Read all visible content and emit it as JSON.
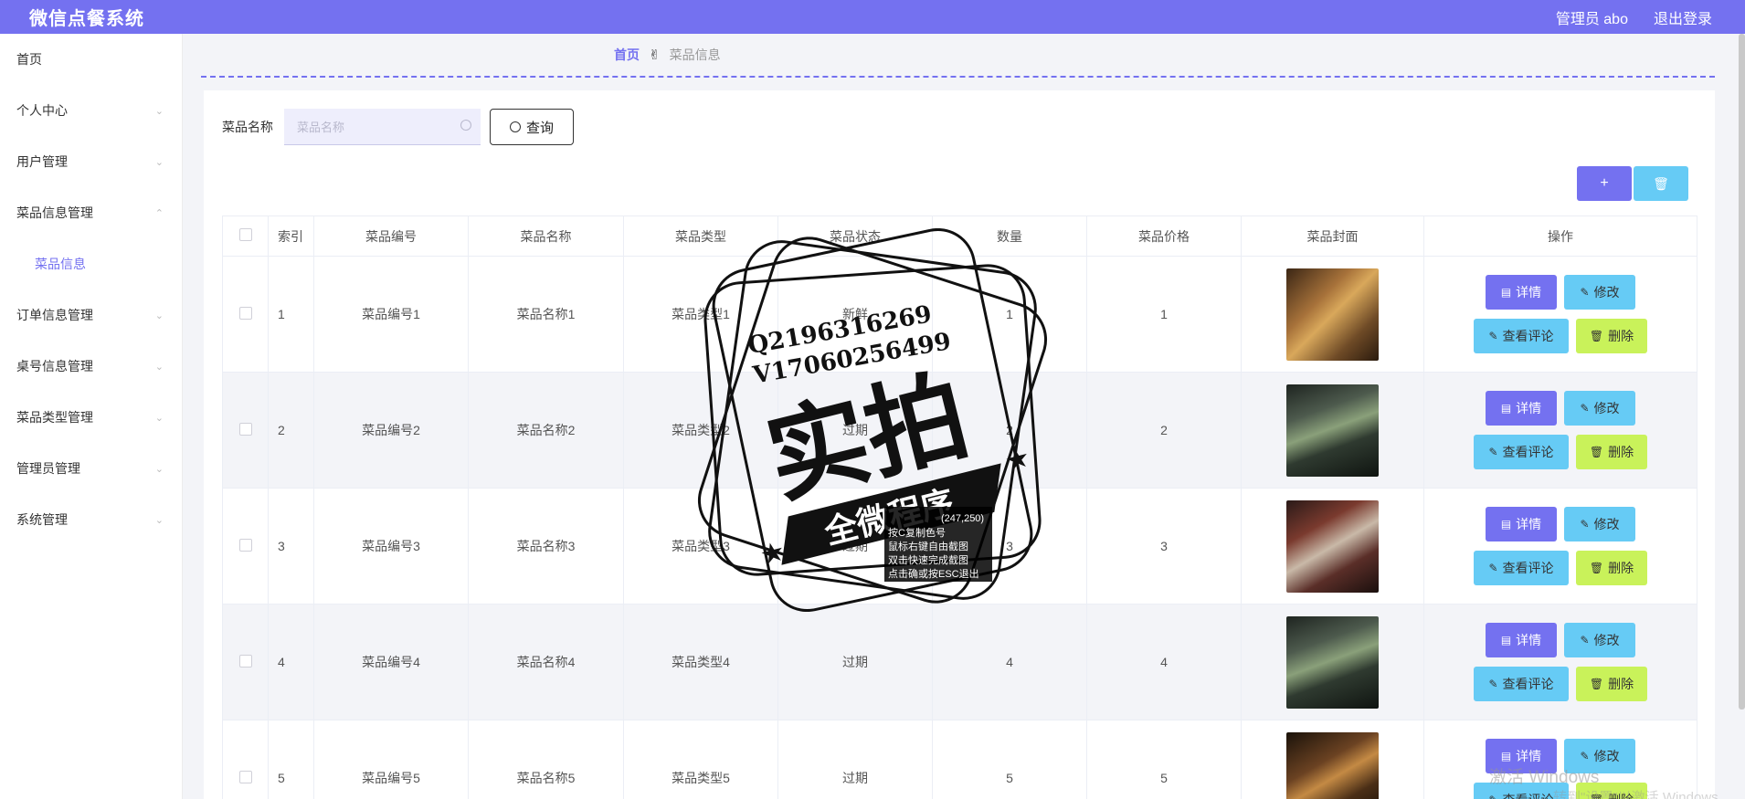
{
  "app": {
    "title": "微信点餐系统",
    "admin_label": "管理员 abo",
    "logout_label": "退出登录"
  },
  "sidebar": {
    "items": [
      {
        "label": "首页",
        "chevron": ""
      },
      {
        "label": "个人中心",
        "chevron": "⌄"
      },
      {
        "label": "用户管理",
        "chevron": "⌄"
      },
      {
        "label": "菜品信息管理",
        "chevron": "⌃"
      },
      {
        "label": "菜品信息",
        "chevron": ""
      },
      {
        "label": "订单信息管理",
        "chevron": "⌄"
      },
      {
        "label": "桌号信息管理",
        "chevron": "⌄"
      },
      {
        "label": "菜品类型管理",
        "chevron": "⌄"
      },
      {
        "label": "管理员管理",
        "chevron": "⌄"
      },
      {
        "label": "系统管理",
        "chevron": "⌄"
      }
    ]
  },
  "breadcrumb": {
    "home": "首页",
    "separator": "✌",
    "current": "菜品信息"
  },
  "search": {
    "label": "菜品名称",
    "placeholder": "菜品名称",
    "button": "查询"
  },
  "toolbar": {
    "add_label": "+",
    "delete_label": "🗑"
  },
  "table": {
    "headers": [
      "",
      "索引",
      "菜品编号",
      "菜品名称",
      "菜品类型",
      "菜品状态",
      "数量",
      "菜品价格",
      "菜品封面",
      "操作"
    ],
    "rows": [
      {
        "index": "1",
        "code": "菜品编号1",
        "name": "菜品名称1",
        "type": "菜品类型1",
        "status": "新鲜",
        "qty": "1",
        "price": "1"
      },
      {
        "index": "2",
        "code": "菜品编号2",
        "name": "菜品名称2",
        "type": "菜品类型2",
        "status": "过期",
        "qty": "2",
        "price": "2"
      },
      {
        "index": "3",
        "code": "菜品编号3",
        "name": "菜品名称3",
        "type": "菜品类型3",
        "status": "过期",
        "qty": "3",
        "price": "3"
      },
      {
        "index": "4",
        "code": "菜品编号4",
        "name": "菜品名称4",
        "type": "菜品类型4",
        "status": "过期",
        "qty": "4",
        "price": "4"
      },
      {
        "index": "5",
        "code": "菜品编号5",
        "name": "菜品名称5",
        "type": "菜品类型5",
        "status": "过期",
        "qty": "5",
        "price": "5"
      }
    ],
    "actions": {
      "detail": "详情",
      "edit": "修改",
      "comment": "查看评论",
      "delete": "删除"
    }
  },
  "watermark": {
    "qq": "Q2196316269",
    "wx": "V17060256499",
    "big": "实拍",
    "ribbon": "全微程序",
    "tooltip": [
      "(247,250)",
      "按C复制色号",
      "鼠标右键自由截图",
      "双击快速完成截图",
      "点击确或按ESC退出"
    ]
  },
  "os_watermark": {
    "line1": "激活 Windows",
    "line2": "转到\"设置\"以激活 Windows"
  }
}
